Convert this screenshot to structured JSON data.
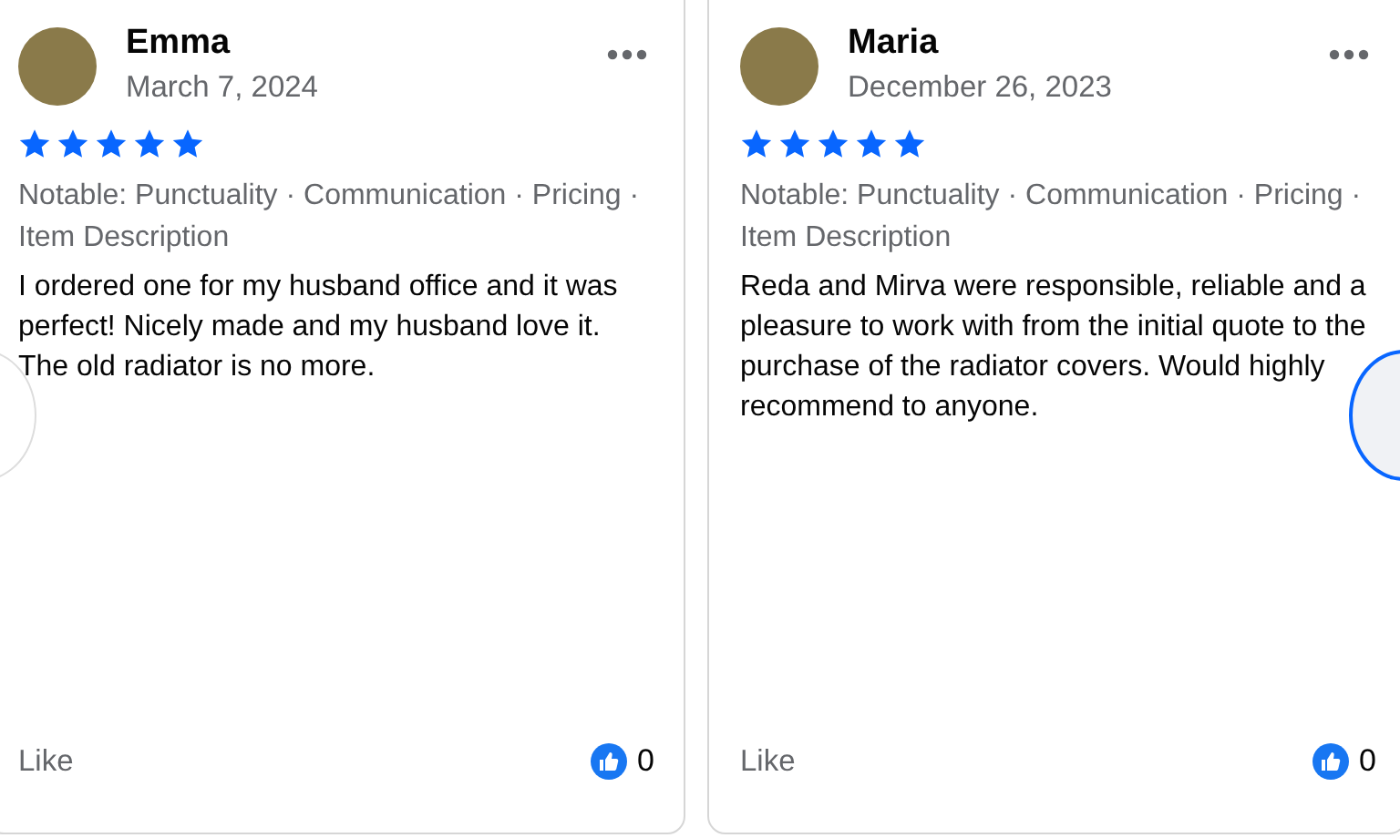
{
  "reviews": [
    {
      "name": "Emma",
      "date": "March 7, 2024",
      "stars": 5,
      "tags": "Notable: Punctuality · Communication · Pricing · Item Description",
      "text": "I ordered one for my husband office and it was perfect! Nicely made and my husband love it. The old radiator is no more.",
      "like_label": "Like",
      "like_count": "0"
    },
    {
      "name": "Maria",
      "date": "December 26, 2023",
      "stars": 5,
      "tags": "Notable: Punctuality · Communication · Pricing · Item Description",
      "text": "Reda and Mirva were responsible, reliable and a pleasure to work with from the initial quote to the purchase of the radiator covers. Would highly recommend to anyone.",
      "like_label": "Like",
      "like_count": "0"
    }
  ]
}
